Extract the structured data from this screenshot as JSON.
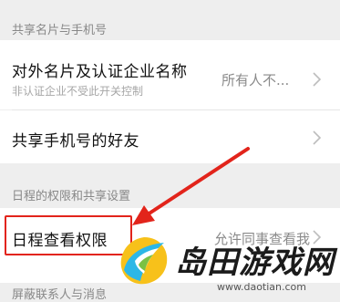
{
  "sections": {
    "share_card": {
      "header": "共享名片与手机号"
    },
    "schedule": {
      "header": "日程的权限和共享设置"
    },
    "blocked": {
      "header": "屏蔽联系人与消息"
    }
  },
  "rows": {
    "external_card": {
      "title": "对外名片及认证企业名称",
      "subtitle": "非认证企业不受此开关控制",
      "value": "所有人不..."
    },
    "share_phone": {
      "title": "共享手机号的好友"
    },
    "schedule_view": {
      "title": "日程查看权限",
      "value": "允许同事查看我"
    }
  },
  "watermark": {
    "brand": "岛田游戏网",
    "url": "www.daotian.com"
  },
  "colors": {
    "annotation_red": "#e2241b",
    "background": "#eeeeee",
    "row_bg": "#ffffff"
  }
}
